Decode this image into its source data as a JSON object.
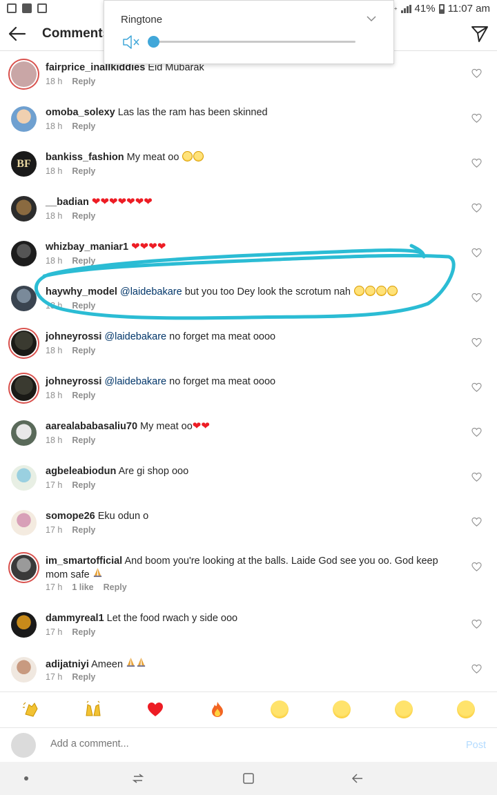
{
  "status_bar": {
    "network": "4G+",
    "battery": "41%",
    "time": "11:07 am"
  },
  "header": {
    "title": "Comments"
  },
  "volume_popup": {
    "label": "Ringtone",
    "level": 0
  },
  "comments": [
    {
      "username": "fairprice_inallkiddies",
      "text": "Eid Mubarak",
      "time": "18 h",
      "reply": "Reply",
      "likes": ""
    },
    {
      "username": "omoba_solexy",
      "text": "Las las the ram has been skinned",
      "time": "18 h",
      "reply": "Reply",
      "likes": ""
    },
    {
      "username": "bankiss_fashion",
      "text": "My meat oo",
      "time": "18 h",
      "reply": "Reply",
      "likes": ""
    },
    {
      "username": "__badian",
      "text": "",
      "time": "18 h",
      "reply": "Reply",
      "likes": ""
    },
    {
      "username": "whizbay_maniar1",
      "text": "",
      "time": "18 h",
      "reply": "Reply",
      "likes": ""
    },
    {
      "username": "haywhy_model",
      "mention": "@laidebakare",
      "text": "but you too Dey look the scrotum nah",
      "time": "18 h",
      "reply": "Reply",
      "likes": ""
    },
    {
      "username": "johneyrossi",
      "mention": "@laidebakare",
      "text": " no forget ma meat oooo",
      "time": "18 h",
      "reply": "Reply",
      "likes": ""
    },
    {
      "username": "johneyrossi",
      "mention": "@laidebakare",
      "text": " no forget ma meat oooo",
      "time": "18 h",
      "reply": "Reply",
      "likes": ""
    },
    {
      "username": "aarealababasaliu70",
      "text": "My meat oo",
      "time": "18 h",
      "reply": "Reply",
      "likes": ""
    },
    {
      "username": "agbeleabiodun",
      "text": "Are gi  shop ooo",
      "time": "17 h",
      "reply": "Reply",
      "likes": ""
    },
    {
      "username": "somope26",
      "text": "Eku odun o",
      "time": "17 h",
      "reply": "Reply",
      "likes": ""
    },
    {
      "username": "im_smartofficial",
      "text": "And boom you're looking at the balls. Laide God see you oo. God keep mom safe",
      "time": "17 h",
      "reply": "Reply",
      "likes": "1 like"
    },
    {
      "username": "dammyreal1",
      "text": "Let the food rwach y side ooo",
      "time": "17 h",
      "reply": "Reply",
      "likes": ""
    },
    {
      "username": "adijatniyi",
      "text": "Ameen",
      "time": "17 h",
      "reply": "Reply",
      "likes": ""
    }
  ],
  "avatar_badges": {
    "bankiss_fashion": "BF"
  },
  "reactions": [
    "clapping-hands",
    "raising-hands",
    "red-heart",
    "fire",
    "crying-face",
    "heart-eyes-face",
    "surprised-face",
    "tears-of-joy-face"
  ],
  "composer": {
    "placeholder": "Add a comment...",
    "post_label": "Post"
  },
  "colors": {
    "accent_blue": "#3897f0",
    "post_disabled": "#b3dbff",
    "mention": "#003569",
    "annotation": "#2bbcd4",
    "volume_knob": "#41a7d9"
  }
}
